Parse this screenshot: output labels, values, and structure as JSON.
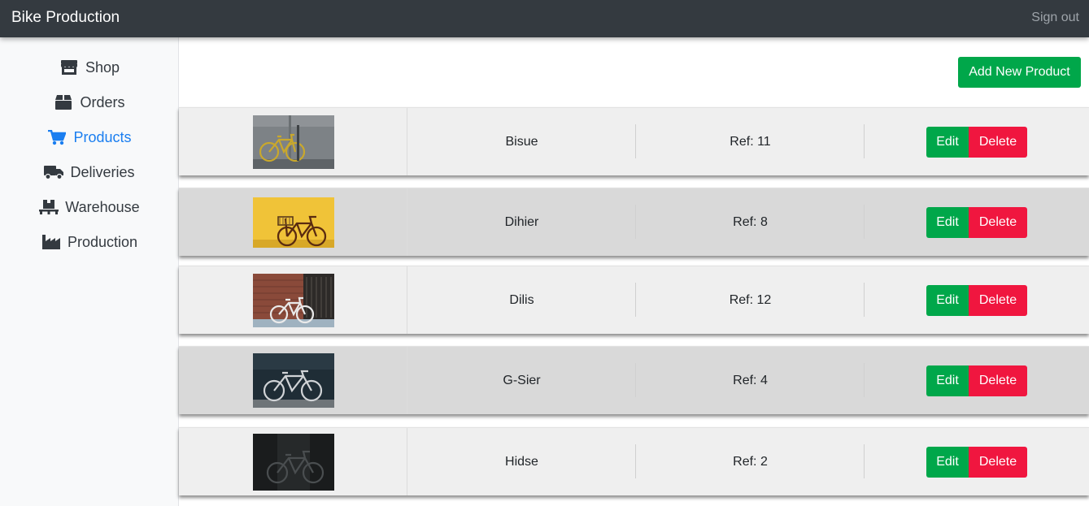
{
  "header": {
    "brand": "Bike Production",
    "signout_label": "Sign out"
  },
  "sidebar": {
    "items": [
      {
        "label": "Shop",
        "icon": "store-icon",
        "active": false
      },
      {
        "label": "Orders",
        "icon": "box-icon",
        "active": false
      },
      {
        "label": "Products",
        "icon": "cart-icon",
        "active": true
      },
      {
        "label": "Deliveries",
        "icon": "truck-icon",
        "active": false
      },
      {
        "label": "Warehouse",
        "icon": "pallet-icon",
        "active": false
      },
      {
        "label": "Production",
        "icon": "industry-icon",
        "active": false
      }
    ]
  },
  "main": {
    "add_button_label": "Add New Product",
    "edit_label": "Edit",
    "delete_label": "Delete",
    "products": [
      {
        "name": "Bisue",
        "ref": "Ref: 11",
        "image": "yellow-bike-on-gray-wall"
      },
      {
        "name": "Dihier",
        "ref": "Ref: 8",
        "image": "bike-with-basket-on-yellow-wall"
      },
      {
        "name": "Dilis",
        "ref": "Ref: 12",
        "image": "white-bike-by-brick-wall"
      },
      {
        "name": "G-Sier",
        "ref": "Ref: 4",
        "image": "road-bike-on-dark-wall"
      },
      {
        "name": "Hidse",
        "ref": "Ref: 2",
        "image": "black-bike-on-black"
      }
    ]
  },
  "colors": {
    "topbar": "#343a40",
    "accent": "#1a7ef0",
    "success": "#00a74a",
    "danger": "#f0163f"
  }
}
